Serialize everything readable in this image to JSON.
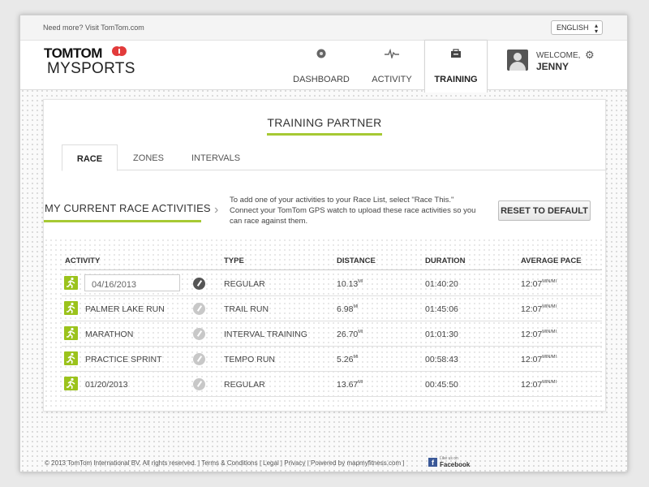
{
  "topbar": {
    "need_more": "Need more? Visit TomTom.com",
    "language": "ENGLISH"
  },
  "brand": {
    "line1": "TOMTOM",
    "line2": "MYSPORTS"
  },
  "nav": {
    "tabs": [
      {
        "label": "DASHBOARD",
        "icon": "dashboard-icon"
      },
      {
        "label": "ACTIVITY",
        "icon": "pulse-icon"
      },
      {
        "label": "TRAINING",
        "icon": "training-icon",
        "active": true
      }
    ]
  },
  "user": {
    "welcome": "WELCOME,",
    "name": "JENNY"
  },
  "page": {
    "title": "TRAINING PARTNER"
  },
  "subtabs": [
    {
      "label": "RACE",
      "active": true
    },
    {
      "label": "ZONES"
    },
    {
      "label": "INTERVALS"
    }
  ],
  "race": {
    "heading": "MY CURRENT RACE ACTIVITIES",
    "info": "To add one of your activities to your Race List, select \"Race This.\" Connect your TomTom GPS watch to upload these race activities so you can race against them.",
    "reset_label": "RESET TO DEFAULT"
  },
  "table": {
    "headers": {
      "activity": "ACTIVITY",
      "type": "TYPE",
      "distance": "DISTANCE",
      "duration": "DURATION",
      "pace": "AVERAGE PACE"
    },
    "distance_unit": "MI",
    "pace_unit": "MIN/MI",
    "rows": [
      {
        "name": "04/16/2013",
        "editing": true,
        "type": "REGULAR",
        "distance": "10.13",
        "duration": "01:40:20",
        "pace": "12:07"
      },
      {
        "name": "PALMER LAKE RUN",
        "type": "TRAIL RUN",
        "distance": "6.98",
        "duration": "01:45:06",
        "pace": "12:07"
      },
      {
        "name": "MARATHON",
        "type": "INTERVAL TRAINING",
        "distance": "26.70",
        "duration": "01:01:30",
        "pace": "12:07"
      },
      {
        "name": "PRACTICE SPRINT",
        "type": "TEMPO RUN",
        "distance": "5.26",
        "duration": "00:58:43",
        "pace": "12:07"
      },
      {
        "name": "01/20/2013",
        "type": "REGULAR",
        "distance": "13.67",
        "duration": "00:45:50",
        "pace": "12:07"
      }
    ]
  },
  "footer": {
    "text": "© 2013 TomTom International BV. All rights reserved.  |  Terms & Conditions  |  Legal  |  Privacy  |  Powered by mapmyfitness.com  |",
    "fb_small": "Like us on",
    "fb_label": "Facebook"
  },
  "colors": {
    "accent": "#a6c933",
    "run_icon": "#9bc31c",
    "facebook": "#3b5998"
  }
}
